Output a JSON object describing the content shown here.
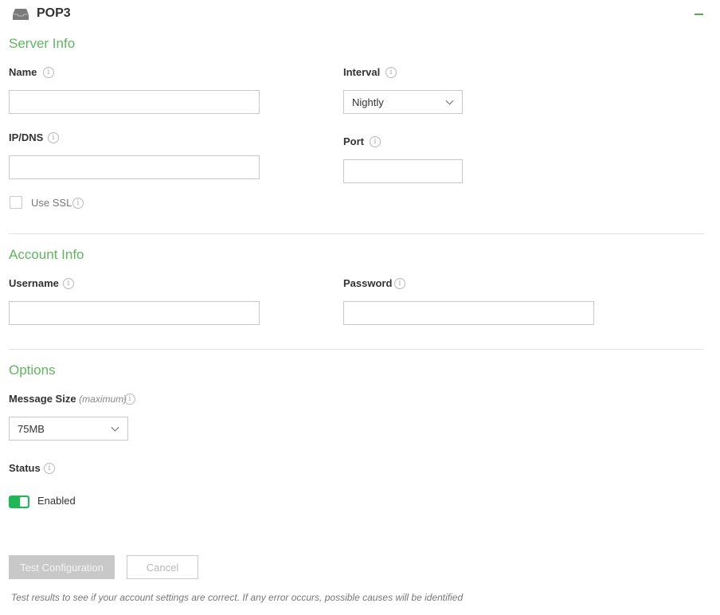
{
  "header": {
    "title": "POP3",
    "icon": "inbox-icon",
    "collapse_icon": "minus-icon",
    "accent": "#5cb85c"
  },
  "server_info": {
    "title": "Server Info",
    "name": {
      "label": "Name",
      "value": "",
      "placeholder": ""
    },
    "interval": {
      "label": "Interval",
      "selected": "Nightly"
    },
    "ip_dns": {
      "label": "IP/DNS",
      "value": "",
      "placeholder": ""
    },
    "port": {
      "label": "Port",
      "value": "",
      "placeholder": ""
    },
    "use_ssl": {
      "label": "Use SSL",
      "checked": false
    }
  },
  "account_info": {
    "title": "Account Info",
    "username": {
      "label": "Username",
      "value": "",
      "placeholder": ""
    },
    "password": {
      "label": "Password",
      "value": "",
      "placeholder": ""
    }
  },
  "options": {
    "title": "Options",
    "message_size": {
      "label": "Message Size",
      "hint": "(maximum)",
      "selected": "75MB"
    },
    "status": {
      "label": "Status",
      "toggle_label": "Enabled",
      "enabled": true,
      "toggle_color": "#1db954"
    }
  },
  "actions": {
    "test_label": "Test Configuration",
    "cancel_label": "Cancel"
  },
  "note": "Test results to see if your account settings are correct. If any error occurs, possible causes will be identified"
}
